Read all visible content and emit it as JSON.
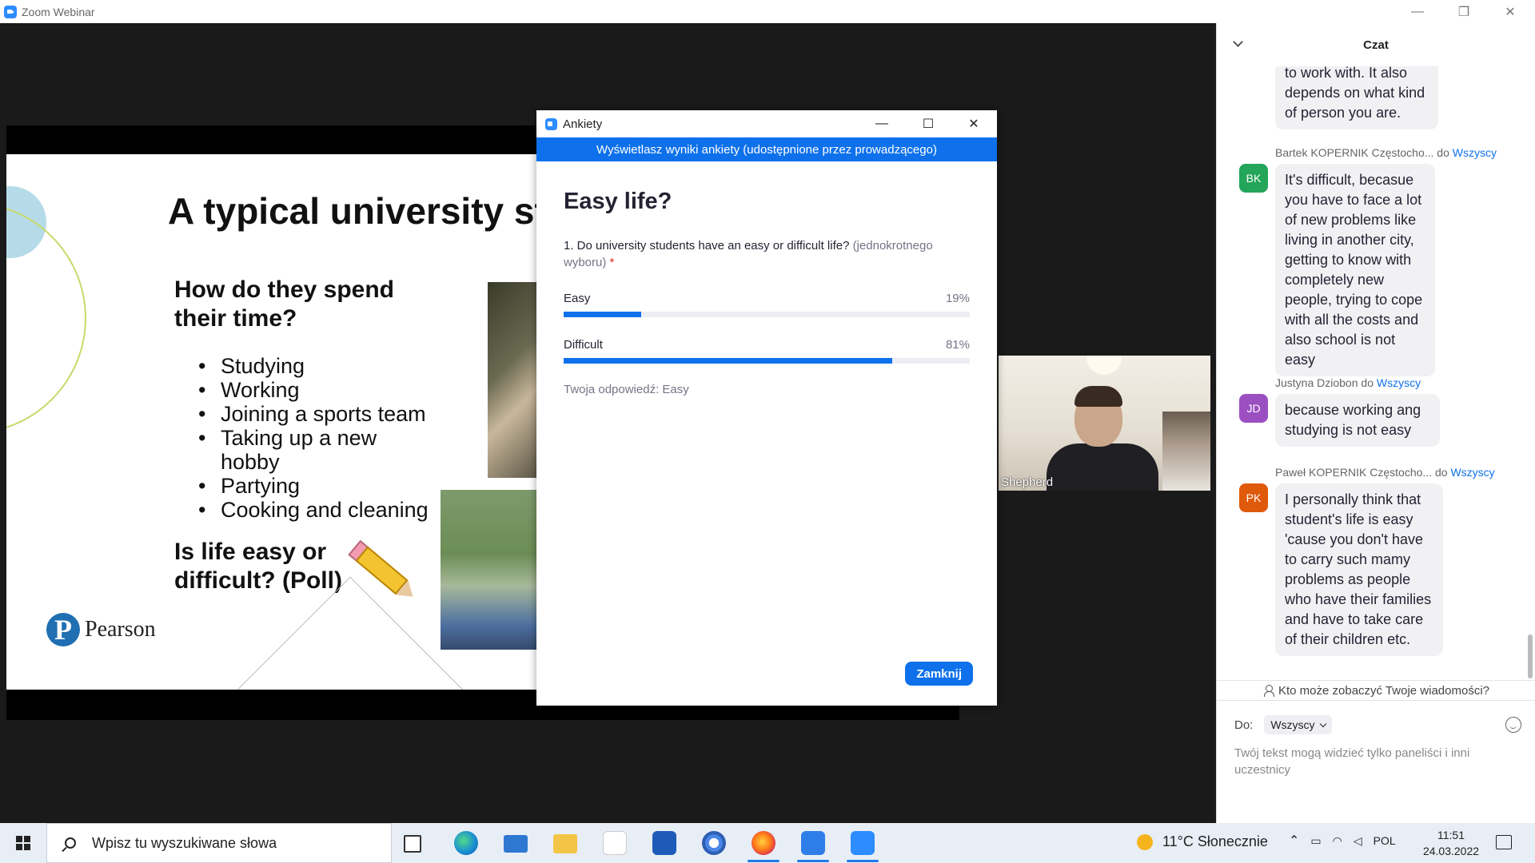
{
  "window": {
    "title": "Zoom Webinar"
  },
  "slide": {
    "title": "A typical university st",
    "subtitle": "How do they spend their time?",
    "bullets": [
      "Studying",
      "Working",
      "Joining a sports team",
      "Taking up a new hobby",
      "Partying",
      "Cooking and cleaning"
    ],
    "question": "Is life easy or difficult? (Poll)",
    "logo_mark": "P",
    "logo_text": "Pearson"
  },
  "video": {
    "name": "Shepherd"
  },
  "poll": {
    "window_title": "Ankiety",
    "banner": "Wyświetlasz wyniki ankiety (udostępnione przez prowadzącego)",
    "heading": "Easy life?",
    "question": "1. Do university students have an easy or difficult life?",
    "question_kind": "(jednokrotnego wyboru)",
    "required_mark": "*",
    "options": [
      {
        "label": "Easy",
        "percent_text": "19%",
        "value": 19
      },
      {
        "label": "Difficult",
        "percent_text": "81%",
        "value": 81
      }
    ],
    "your_answer": "Twoja odpowiedź: Easy",
    "close_label": "Zamknij",
    "accent_color": "#0e71eb"
  },
  "chat": {
    "header": "Czat",
    "messages": [
      {
        "sender": "",
        "to": "",
        "initials": "",
        "text": "to work with. It also depends on what kind of person you are."
      },
      {
        "sender": "Bartek KOPERNIK Częstocho...",
        "to_prefix": "do",
        "to": "Wszyscy",
        "initials": "BK",
        "avatar_color": "#23a55a",
        "text": "It's difficult, becasue you have to face a lot of new problems like living in another city, getting to know with completely new people, trying to cope with all the costs and also school is not easy"
      },
      {
        "sender": "Justyna Dziobon",
        "to_prefix": "do",
        "to": "Wszyscy",
        "initials": "JD",
        "avatar_color": "#9b4fc1",
        "text": "because working ang studying is not easy"
      },
      {
        "sender": "Paweł KOPERNIK Częstocho...",
        "to_prefix": "do",
        "to": "Wszyscy",
        "initials": "PK",
        "avatar_color": "#e05a0c",
        "text": "I personally think that student's life is easy 'cause you don't have to carry such mamy problems as people who have their families and have to take care of their children etc."
      }
    ],
    "privacy_text": "Kto może zobaczyć Twoje wiadomości?",
    "to_label": "Do:",
    "to_value": "Wszyscy",
    "input_placeholder": "Twój tekst mogą widzieć tylko paneliści i inni uczestnicy"
  },
  "taskbar": {
    "search_placeholder": "Wpisz tu wyszukiwane słowa",
    "weather": "11°C  Słonecznie",
    "language": "POL",
    "time": "11:51",
    "date": "24.03.2022"
  }
}
